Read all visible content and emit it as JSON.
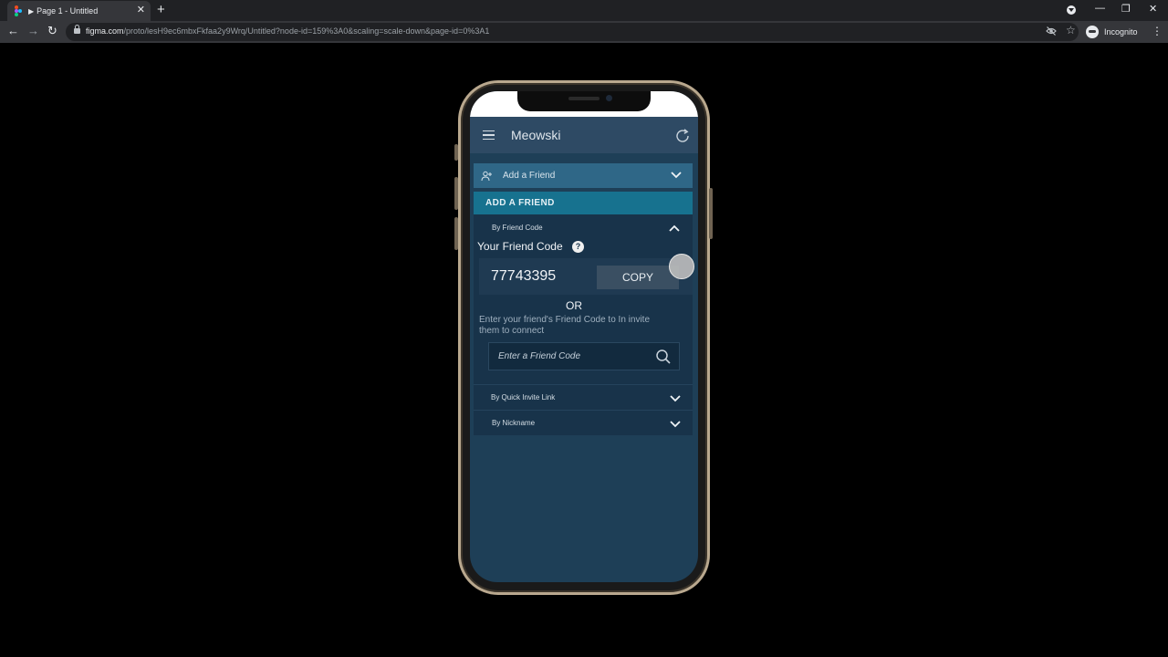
{
  "browser": {
    "tab_title": "Page 1 - Untitled",
    "tab_close": "✕",
    "new_tab": "+",
    "url_host": "figma.com",
    "url_path": "/proto/lesH9ec6mbxFkfaa2y9Wrq/Untitled?node-id=159%3A0&scaling=scale-down&page-id=0%3A1",
    "incognito_label": "Incognito",
    "icons": [
      "back-icon",
      "forward-icon",
      "reload-icon",
      "lock-icon",
      "eye-off-icon",
      "star-icon",
      "incognito-icon",
      "menu-dots-icon"
    ]
  },
  "app": {
    "title": "Meowski",
    "add_friend_dropdown": "Add a Friend",
    "section_header": "ADD A FRIEND",
    "by_friend_code": "By Friend Code",
    "your_friend_code_label": "Your Friend Code",
    "help_symbol": "?",
    "friend_code": "77743395",
    "copy_label": "COPY",
    "or_label": "OR",
    "instructions": "Enter your friend's Friend Code to In invite them to connect",
    "input_placeholder": "Enter a Friend Code",
    "by_quick_invite_link": "By Quick Invite Link",
    "by_nickname": "By Nickname"
  },
  "colors": {
    "app_bar": "#2e4a64",
    "dropdown": "#2f6787",
    "section_header": "#17728f",
    "panel": "#18334a",
    "screen_bg": "#1e3f57"
  }
}
